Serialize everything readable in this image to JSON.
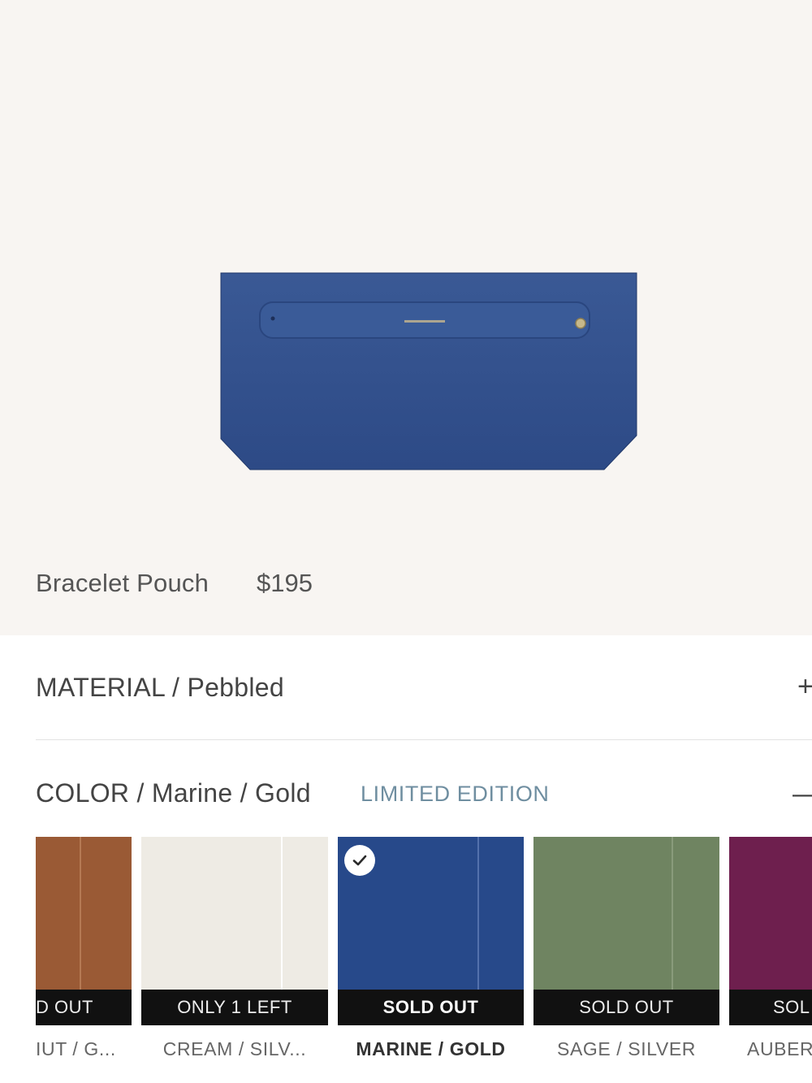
{
  "product": {
    "name": "Bracelet Pouch",
    "price": "$195",
    "image_color": "#34528e"
  },
  "material": {
    "title": "MATERIAL / Pebbled",
    "toggle_icon": "plus-icon",
    "toggle_symbol": "+"
  },
  "color": {
    "title": "COLOR / Marine / Gold",
    "badge": "LIMITED EDITION",
    "toggle_icon": "minus-icon",
    "toggle_symbol": "—"
  },
  "swatches": [
    {
      "label": "IUT / G...",
      "status": "D OUT",
      "color": "#9a5a35",
      "selected": false
    },
    {
      "label": "CREAM / SILV...",
      "status": "ONLY 1 LEFT",
      "color": "#eeebe4",
      "selected": false
    },
    {
      "label": "MARINE / GOLD",
      "status": "SOLD OUT",
      "color": "#27498a",
      "selected": true
    },
    {
      "label": "SAGE / SILVER",
      "status": "SOLD OUT",
      "color": "#6f8461",
      "selected": false
    },
    {
      "label": "AUBER",
      "status": "SOL",
      "color": "#6e1f4e",
      "selected": false
    }
  ]
}
